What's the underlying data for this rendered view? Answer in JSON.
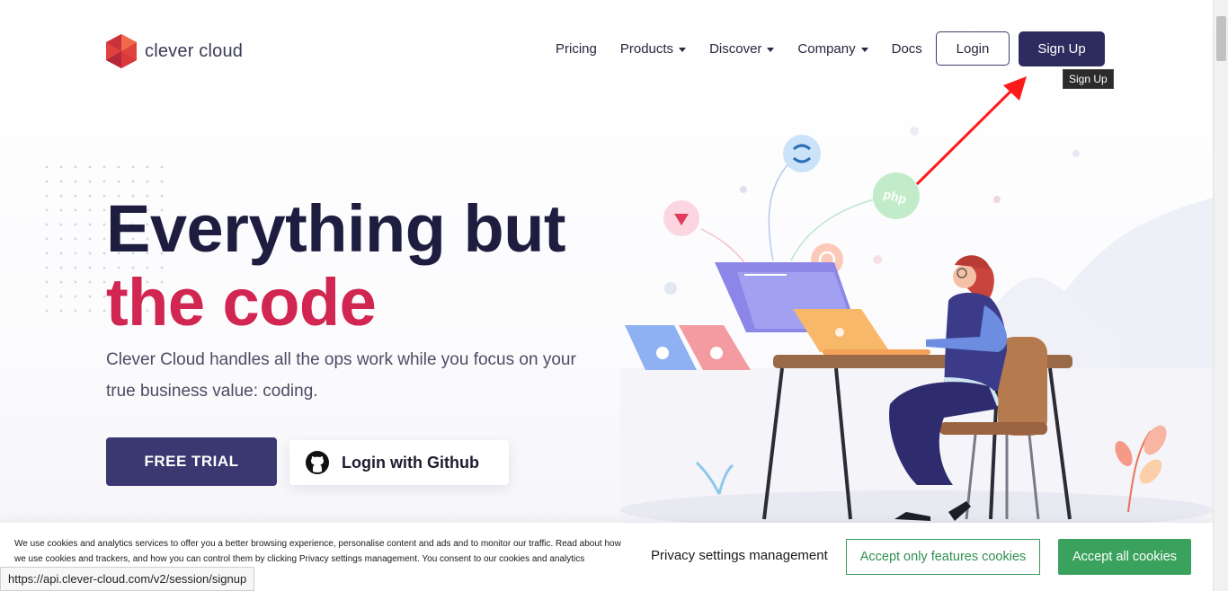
{
  "brand": {
    "name": "clever cloud"
  },
  "nav": {
    "items": [
      {
        "label": "Pricing",
        "dropdown": false
      },
      {
        "label": "Products",
        "dropdown": true
      },
      {
        "label": "Discover",
        "dropdown": true
      },
      {
        "label": "Company",
        "dropdown": true
      },
      {
        "label": "Docs",
        "dropdown": false
      }
    ],
    "login_label": "Login",
    "signup_label": "Sign Up",
    "signup_tooltip": "Sign Up"
  },
  "hero": {
    "title_line1": "Everything but",
    "title_line2": "the code",
    "subtitle": "Clever Cloud handles all the ops work while you focus on your true business value: coding.",
    "trial_label": "FREE TRIAL",
    "github_label": "Login with Github"
  },
  "illustration": {
    "php_badge": "php"
  },
  "cookie_banner": {
    "text": "We use cookies and analytics services to offer you a better browsing experience, personalise content and ads and to monitor our traffic. Read about how we use cookies and trackers, and how you can control them by clicking Privacy settings management. You consent to our cookies and analytics",
    "privacy_label": "Privacy settings management",
    "features_label": "Accept only features cookies",
    "accept_all_label": "Accept all cookies"
  },
  "status_bar": {
    "url": "https://api.clever-cloud.com/v2/session/signup"
  },
  "colors": {
    "brand_dark": "#2e2c5f",
    "accent_red": "#d12651",
    "cookie_green": "#3aa25c",
    "annotation_arrow": "#ff1a1a"
  }
}
